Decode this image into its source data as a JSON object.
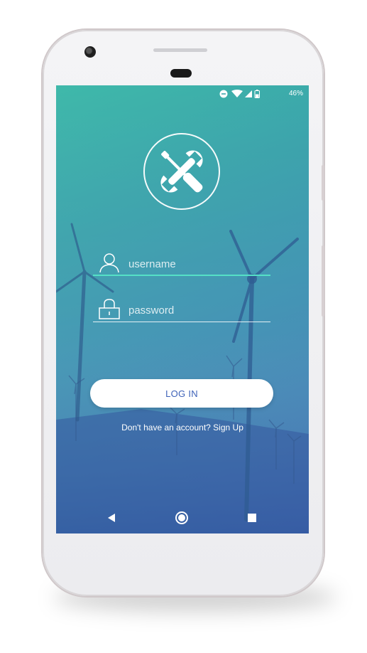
{
  "status_bar": {
    "battery_percent": "46%",
    "icons": [
      "do-not-disturb-icon",
      "wifi-icon",
      "signal-icon",
      "battery-icon"
    ]
  },
  "login": {
    "username_placeholder": "username",
    "password_placeholder": "password",
    "login_label": "LOG IN",
    "signup_text": "Don't have an account? Sign Up"
  },
  "nav": {
    "icons": [
      "back-icon",
      "home-icon",
      "recents-icon"
    ]
  },
  "colors": {
    "gradient_top": "#3fb9aa",
    "gradient_bottom": "#3e6fb5",
    "active_underline": "#55e0c6",
    "button_text": "#3e62b8"
  }
}
